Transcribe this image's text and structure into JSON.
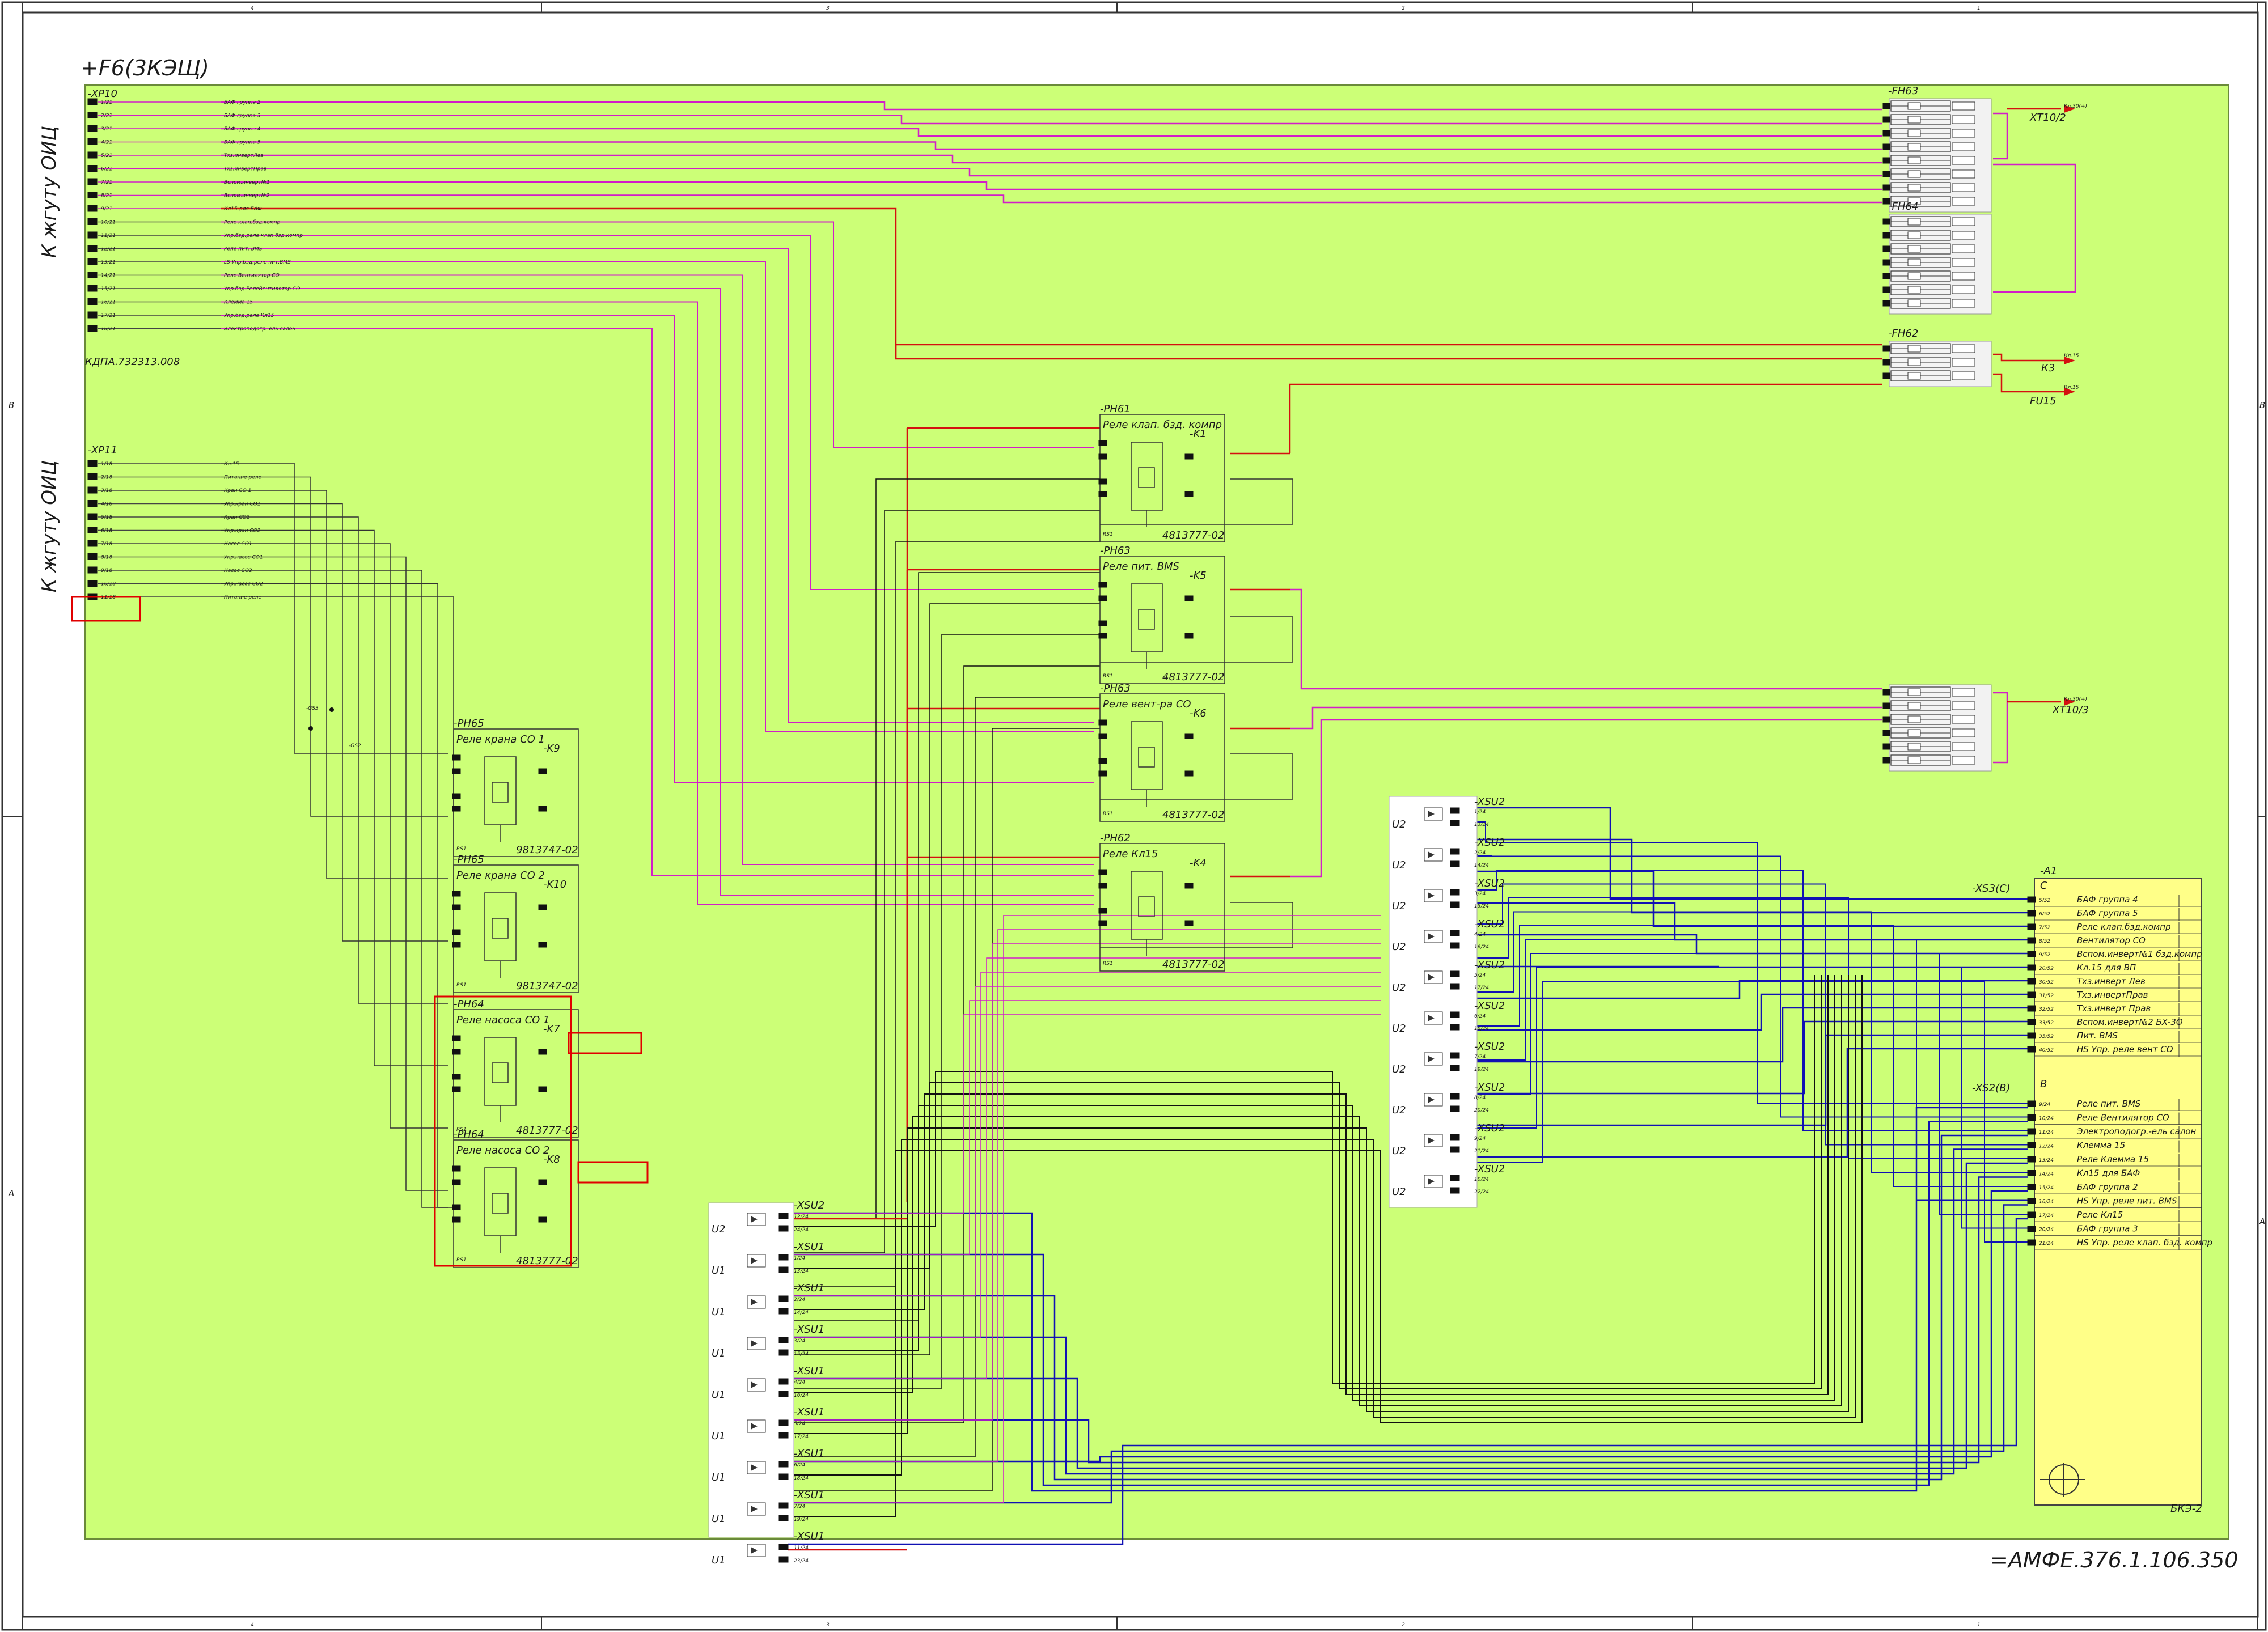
{
  "colors": {
    "background_zone": "#ccff77",
    "wire_magenta": "#d21ec8",
    "wire_red": "#d41010",
    "wire_blue": "#1111b4",
    "wire_black": "#111111",
    "wire_grey": "#777777",
    "box_a1": "#ffff88",
    "highlight": "#e00000"
  },
  "frame": {
    "top_columns": [
      "4",
      "3",
      "2",
      "1"
    ],
    "side_rows": [
      "B",
      "A"
    ]
  },
  "header": {
    "zone_title": "+F6(3КЭЩ)",
    "doc_number": "=АМФЕ.376.1.106.350"
  },
  "xp10": {
    "tag": "-XP10",
    "side_label": "К жгуту ОИЦ",
    "part_number": "КДПА.732313.008",
    "rows": [
      {
        "pin": "1/21",
        "label": "БАФ группа 2"
      },
      {
        "pin": "2/21",
        "label": "БАФ группа 3"
      },
      {
        "pin": "3/21",
        "label": "БАФ группа 4"
      },
      {
        "pin": "4/21",
        "label": "БАФ группа 5"
      },
      {
        "pin": "5/21",
        "label": "Тхз.инвертЛев"
      },
      {
        "pin": "6/21",
        "label": "Тхз.инвертПрав"
      },
      {
        "pin": "7/21",
        "label": "Вспом.инверт№1"
      },
      {
        "pin": "8/21",
        "label": "Вспом.инверт№2"
      },
      {
        "pin": "9/21",
        "label": "Кл15 для БАФ"
      },
      {
        "pin": "10/21",
        "label": "Реле клап.бзд.компр"
      },
      {
        "pin": "11/21",
        "label": "Упр.бзд.реле клап.бзд.компр"
      },
      {
        "pin": "12/21",
        "label": "Реле пит. ВМS"
      },
      {
        "pin": "13/21",
        "label": "LS Упр.бзд.реле пит.BMS"
      },
      {
        "pin": "14/21",
        "label": "Реле Вентилятор СО"
      },
      {
        "pin": "15/21",
        "label": "Упр.бзд.РелеВентилятор СО"
      },
      {
        "pin": "16/21",
        "label": "Клемма 15"
      },
      {
        "pin": "17/21",
        "label": "Упр.бзд.реле Кл15"
      },
      {
        "pin": "18/21",
        "label": "Электроподогр.-ель салон"
      }
    ]
  },
  "xp11": {
    "tag": "-XP11",
    "side_label": "К жгуту ОИЦ",
    "rows": [
      {
        "pin": "1/18",
        "label": "Кл.15"
      },
      {
        "pin": "2/18",
        "label": "Питание реле"
      },
      {
        "pin": "3/18",
        "label": "Кран СО 1"
      },
      {
        "pin": "4/18",
        "label": "Упр.кран СО1"
      },
      {
        "pin": "5/18",
        "label": "Кран СО2"
      },
      {
        "pin": "6/18",
        "label": "Упр.кран СО2"
      },
      {
        "pin": "7/18",
        "label": "Насос СО1"
      },
      {
        "pin": "8/18",
        "label": "Упр.насос СО1"
      },
      {
        "pin": "9/18",
        "label": "Насос СО2"
      },
      {
        "pin": "10/18",
        "label": "Упр.насос СО2"
      },
      {
        "pin": "11/18",
        "label": "Питание реле"
      }
    ]
  },
  "relays": [
    {
      "pos": "-РН61",
      "title": "Реле клап. бзд. компр",
      "tag": "-K1",
      "part": "4813777-02"
    },
    {
      "pos": "-РН63",
      "title": "Реле пит. ВМS",
      "tag": "-K5",
      "part": "4813777-02"
    },
    {
      "pos": "-РН63",
      "title": "Реле вент-ра СО",
      "tag": "-K6",
      "part": "4813777-02"
    },
    {
      "pos": "-РН62",
      "title": "Реле Кл15",
      "tag": "-K4",
      "part": "4813777-02"
    },
    {
      "pos": "-РН65",
      "title": "Реле крана СО 1",
      "tag": "-K9",
      "part": "9813747-02"
    },
    {
      "pos": "-РН65",
      "title": "Реле крана СО 2",
      "tag": "-K10",
      "part": "9813747-02"
    },
    {
      "pos": "-РН64",
      "title": "Реле насоса СО 1",
      "tag": "-K7",
      "part": "4813777-02"
    },
    {
      "pos": "-РН64",
      "title": "Реле насоса СО 2",
      "tag": "-K8",
      "part": "4813777-02"
    }
  ],
  "fuse_blocks": [
    {
      "tag": "-FH63",
      "out_label": "XT10/2",
      "terminal": "Кл.30(+)"
    },
    {
      "tag": "-FH64"
    },
    {
      "tag": "-FH62",
      "out_label": "K3",
      "terminal2": "FU15"
    },
    {
      "tag": "",
      "out_label": "XT10/3",
      "terminal": "Кл.30(+)"
    }
  ],
  "a1": {
    "tag": "-A1",
    "conn_c": "-XS3(C)",
    "conn_b": "-XS2(B)",
    "section_c": "C",
    "section_b": "B",
    "model": "БКЭ-2",
    "rows_c": [
      {
        "pin": "5/52",
        "label": "БАФ группа 4"
      },
      {
        "pin": "6/52",
        "label": "БАФ группа 5"
      },
      {
        "pin": "7/52",
        "label": "Реле клап.бзд.компр"
      },
      {
        "pin": "8/52",
        "label": "Вентилятор СО"
      },
      {
        "pin": "9/52",
        "label": "Вспом.инверт№1 бзд.компр"
      },
      {
        "pin": "20/52",
        "label": "Кл.15 для ВП"
      },
      {
        "pin": "30/52",
        "label": "Тхз.инверт Лев"
      },
      {
        "pin": "31/52",
        "label": "Тхз.инвертПрав"
      },
      {
        "pin": "32/52",
        "label": "Тхз.инверт Прав"
      },
      {
        "pin": "33/52",
        "label": "Вспом.инверт№2 БХ-3О"
      },
      {
        "pin": "35/52",
        "label": "Пит. ВМS"
      },
      {
        "pin": "40/52",
        "label": "HS Упр. реле вент СО"
      }
    ],
    "rows_b": [
      {
        "pin": "9/24",
        "label": "Реле пит. ВМS"
      },
      {
        "pin": "10/24",
        "label": "Реле Вентилятор СО"
      },
      {
        "pin": "11/24",
        "label": "Электроподогр.-ель салон"
      },
      {
        "pin": "12/24",
        "label": "Клемма 15"
      },
      {
        "pin": "13/24",
        "label": "Реле Клемма 15"
      },
      {
        "pin": "14/24",
        "label": "Кл15 для БАФ"
      },
      {
        "pin": "15/24",
        "label": "БАФ группа 2"
      },
      {
        "pin": "16/24",
        "label": "HS Упр. реле пит. ВМS"
      },
      {
        "pin": "17/24",
        "label": "Реле Кл15"
      },
      {
        "pin": "20/24",
        "label": "БАФ группа 3"
      },
      {
        "pin": "21/24",
        "label": "HS Упр. реле клап. бзд. компр"
      }
    ]
  },
  "xsu2_right": {
    "tag": "-XSU2",
    "diode_label": "U2",
    "pins": [
      "1/24",
      "13/24",
      "2/24",
      "14/24",
      "3/24",
      "15/24",
      "4/24",
      "16/24",
      "5/24",
      "17/24",
      "6/24",
      "18/24",
      "7/24",
      "19/24",
      "8/24",
      "20/24",
      "9/24",
      "21/24",
      "10/24",
      "22/24"
    ]
  },
  "xsu_left": {
    "tags": [
      "-XSU2",
      "-XSU1",
      "-XSU1",
      "-XSU1",
      "-XSU1",
      "-XSU1",
      "-XSU1",
      "-XSU1",
      "-XSU1"
    ],
    "pins": [
      "12/24",
      "24/24",
      "1/24",
      "13/24",
      "2/24",
      "14/24",
      "3/24",
      "15/24",
      "4/24",
      "16/24",
      "5/24",
      "17/24",
      "6/24",
      "18/24",
      "7/24",
      "19/24",
      "11/24",
      "23/24"
    ],
    "diode_labels": [
      "U2",
      "U1",
      "U1",
      "U1",
      "U1",
      "U1",
      "U1",
      "U1",
      "U1"
    ]
  },
  "misc": {
    "gs3": "-GS3",
    "gs2": "-GS2",
    "k3": "К3",
    "fu15": "FU15",
    "xt10_3": "XT10/3",
    "xt10_2": "XT10/2",
    "kl15": "Кл.15",
    "kl15_2": "Кл.15"
  }
}
